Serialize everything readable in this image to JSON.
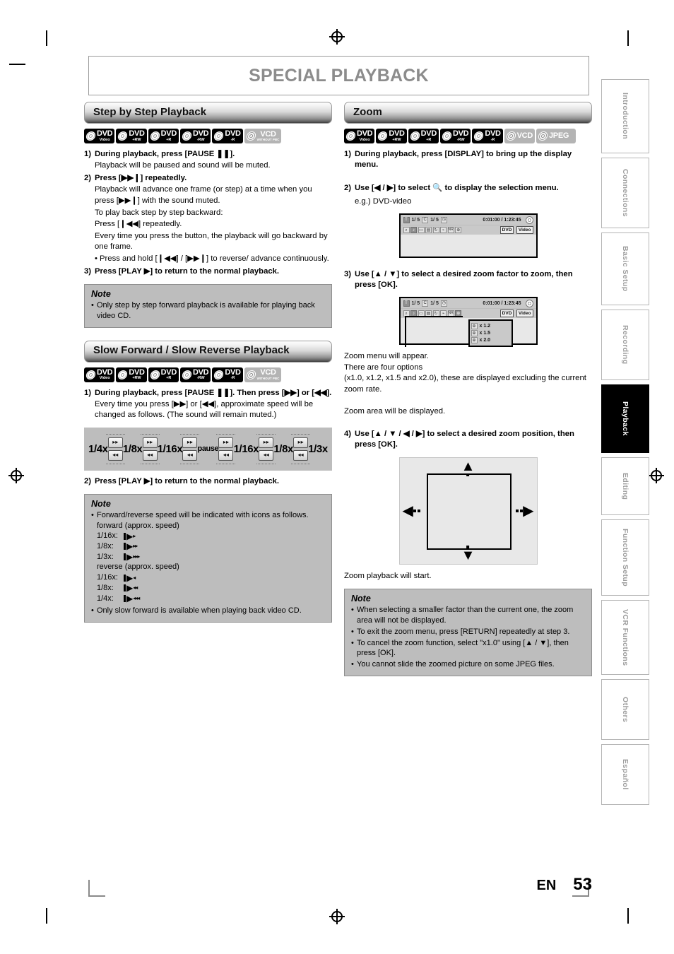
{
  "page": {
    "title": "SPECIAL PLAYBACK",
    "language_code": "EN",
    "page_number": "53"
  },
  "sidebar": {
    "tabs": [
      {
        "label": "Introduction",
        "active": false
      },
      {
        "label": "Connections",
        "active": false
      },
      {
        "label": "Basic Setup",
        "active": false
      },
      {
        "label": "Recording",
        "active": false
      },
      {
        "label": "Playback",
        "active": true
      },
      {
        "label": "Editing",
        "active": false
      },
      {
        "label": "Function Setup",
        "active": false
      },
      {
        "label": "VCR Functions",
        "active": false
      },
      {
        "label": "Others",
        "active": false
      },
      {
        "label": "Español",
        "active": false
      }
    ]
  },
  "left_column": {
    "section1": {
      "heading": "Step by Step Playback",
      "disc_badges": [
        {
          "big": "DVD",
          "sub": "Video",
          "style": "dark"
        },
        {
          "big": "DVD",
          "sub": "+RW",
          "style": "dark"
        },
        {
          "big": "DVD",
          "sub": "+R",
          "style": "dark"
        },
        {
          "big": "DVD",
          "sub": "-RW",
          "style": "dark"
        },
        {
          "big": "DVD",
          "sub": "-R",
          "style": "dark"
        },
        {
          "big": "VCD",
          "sub": "WITHOUT PBC",
          "style": "grey"
        }
      ],
      "steps": [
        {
          "num": "1)",
          "bold": "During playback, press [PAUSE ❚❚]."
        },
        {
          "num": "2)",
          "bold": "Press [▶▶❙] repeatedly."
        },
        {
          "num": "3)",
          "bold": "Press [PLAY ▶] to return to the normal playback."
        }
      ],
      "step1_body": "Playback will be paused and sound will be muted.",
      "step2_body_1": "Playback will advance one frame (or step) at a time when you press [▶▶❙] with the sound muted.",
      "step2_body_2": "To play back step by step backward:",
      "step2_body_3": "Press [❙◀◀] repeatedly.",
      "step2_body_4": "Every time you press the button, the playback will go backward by one frame.",
      "step2_bullet": "Press and hold [❙◀◀] / [▶▶❙] to reverse/ advance continuously.",
      "note": {
        "title": "Note",
        "items": [
          "Only step by step forward playback is available for playing back video CD."
        ]
      }
    },
    "section2": {
      "heading": "Slow Forward / Slow Reverse Playback",
      "disc_badges": [
        {
          "big": "DVD",
          "sub": "Video",
          "style": "dark"
        },
        {
          "big": "DVD",
          "sub": "+RW",
          "style": "dark"
        },
        {
          "big": "DVD",
          "sub": "+R",
          "style": "dark"
        },
        {
          "big": "DVD",
          "sub": "-RW",
          "style": "dark"
        },
        {
          "big": "DVD",
          "sub": "-R",
          "style": "dark"
        },
        {
          "big": "VCD",
          "sub": "WITHOUT PBC",
          "style": "grey"
        }
      ],
      "step1_bold": "During playback, press [PAUSE ❚❚]. Then press [▶▶] or [◀◀].",
      "step1_body": "Every time you press [▶▶] or [◀◀], approximate speed will be changed as follows. (The sound will remain muted.)",
      "speed_diagram": {
        "labels": [
          "1/4x",
          "1/8x",
          "1/16x",
          "pause",
          "1/16x",
          "1/8x",
          "1/3x"
        ],
        "button_forward_glyph": "▸▸",
        "button_reverse_glyph": "◂◂"
      },
      "step2_bold": "Press [PLAY ▶] to return to the normal playback.",
      "note": {
        "title": "Note",
        "bullet1": "Forward/reverse speed will be indicated with icons as follows.",
        "forward_label": "forward (approx. speed)",
        "forward_rows": [
          {
            "key": "1/16x:",
            "arrows": 1
          },
          {
            "key": "1/8x:",
            "arrows": 2
          },
          {
            "key": "1/3x:",
            "arrows": 3
          }
        ],
        "reverse_label": "reverse (approx. speed)",
        "reverse_rows": [
          {
            "key": "1/16x:",
            "arrows": 1
          },
          {
            "key": "1/8x:",
            "arrows": 2
          },
          {
            "key": "1/4x:",
            "arrows": 3
          }
        ],
        "bullet2": "Only slow forward is available when playing back video CD."
      }
    }
  },
  "right_column": {
    "section": {
      "heading": "Zoom",
      "disc_badges": [
        {
          "big": "DVD",
          "sub": "Video",
          "style": "dark"
        },
        {
          "big": "DVD",
          "sub": "+RW",
          "style": "dark"
        },
        {
          "big": "DVD",
          "sub": "+R",
          "style": "dark"
        },
        {
          "big": "DVD",
          "sub": "-RW",
          "style": "dark"
        },
        {
          "big": "DVD",
          "sub": "-R",
          "style": "dark"
        },
        {
          "big": "VCD",
          "sub": "",
          "style": "grey"
        },
        {
          "big": "JPEG",
          "sub": "",
          "style": "grey"
        }
      ],
      "step1": "During playback, press [DISPLAY] to bring up the display menu.",
      "step2": "Use [◀ / ▶] to select 🔍 to display the selection menu.",
      "step2_example": "e.g.) DVD-video",
      "osd1": {
        "title_icon": "T",
        "title_val": "1/ 5",
        "chapter_icon": "C",
        "chapter_val": "1/ 5",
        "time_icon": "clock-icon",
        "time": "0:01:00 / 1:23:45",
        "tag1": "DVD",
        "tag2": "Video"
      },
      "step3": "Use [▲ / ▼] to select a desired zoom factor to zoom, then press [OK].",
      "zoom_menu_options": [
        "x 1.2",
        "x 1.5",
        "x 2.0"
      ],
      "after3_line1": "Zoom menu will appear.",
      "after3_line2": "There are four options",
      "after3_line3": "(x1.0, x1.2, x1.5 and x2.0), these are displayed excluding the current zoom rate.",
      "after3_line4": "Zoom area will be displayed.",
      "step4": "Use [▲ / ▼ / ◀ / ▶] to select a desired zoom position, then press [OK].",
      "after4_line": "Zoom playback will start.",
      "note": {
        "title": "Note",
        "items": [
          "When selecting a smaller factor than the current one, the zoom area will not be displayed.",
          "To exit the zoom menu, press [RETURN] repeatedly at step 3.",
          "To cancel the zoom function, select \"x1.0\" using [▲ / ▼], then press [OK].",
          "You cannot slide the zoomed picture on some JPEG files."
        ]
      }
    }
  },
  "colors": {
    "note_bg": "#bdbdbd",
    "title_grey": "#8c8c8c",
    "tab_inactive_text": "#9d9d9d",
    "osd_bg": "#c9c9c9",
    "screen_bg": "#e8e8e8"
  }
}
